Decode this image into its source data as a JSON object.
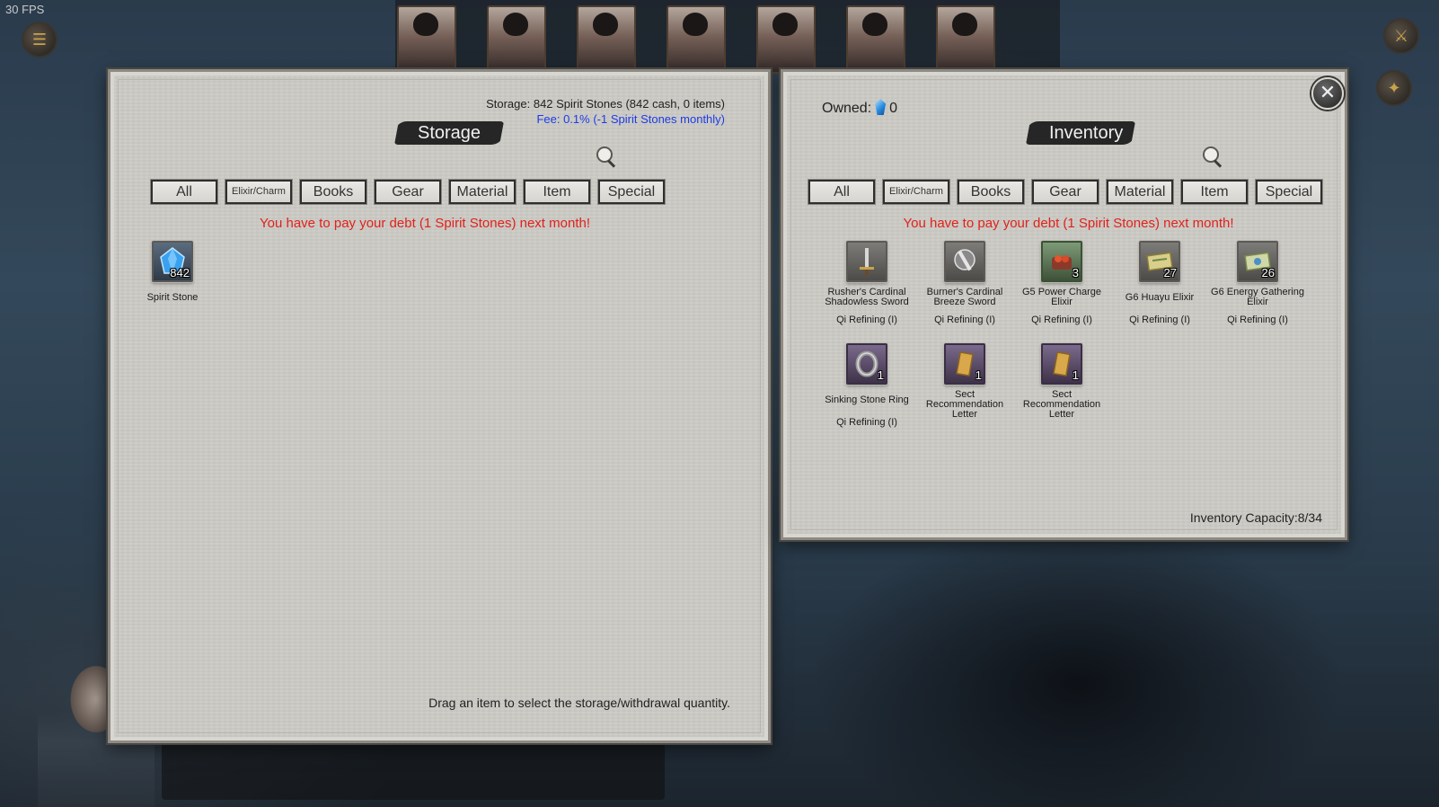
{
  "hud": {
    "fps": "30 FPS"
  },
  "storage": {
    "title": "Storage",
    "storage_line": "Storage: 842 Spirit Stones (842 cash, 0 items)",
    "fee_line": "Fee: 0.1% (-1 Spirit Stones monthly)",
    "tabs": [
      "All",
      "Elixir/Charm",
      "Books",
      "Gear",
      "Material",
      "Item",
      "Special"
    ],
    "debt_message": "You have to pay your debt (1 Spirit Stones) next month!",
    "items": [
      {
        "name": "Spirit Stone",
        "qty": "842",
        "icon": "spirit-stone-icon"
      }
    ],
    "footer": "Drag an item to select the storage/withdrawal quantity."
  },
  "inventory": {
    "title": "Inventory",
    "owned_label": "Owned:",
    "owned_value": "0",
    "tabs": [
      "All",
      "Elixir/Charm",
      "Books",
      "Gear",
      "Material",
      "Item",
      "Special"
    ],
    "debt_message": "You have to pay your debt (1 Spirit Stones) next month!",
    "items": [
      {
        "name": "Rusher's Cardinal Shadowless Sword",
        "qty": "",
        "realm": "Qi Refining (I)",
        "icon": "sword-icon"
      },
      {
        "name": "Burner's Cardinal Breeze Sword",
        "qty": "",
        "realm": "Qi Refining (I)",
        "icon": "sword-icon"
      },
      {
        "name": "G5 Power Charge Elixir",
        "qty": "3",
        "realm": "Qi Refining (I)",
        "icon": "elixir-icon"
      },
      {
        "name": "G6 Huayu Elixir",
        "qty": "27",
        "realm": "Qi Refining (I)",
        "icon": "scroll-icon"
      },
      {
        "name": "G6 Energy Gathering Elixir",
        "qty": "26",
        "realm": "Qi Refining (I)",
        "icon": "scroll-icon"
      },
      {
        "name": "Sinking Stone Ring",
        "qty": "1",
        "realm": "Qi Refining (I)",
        "icon": "ring-icon"
      },
      {
        "name": "Sect Recommendation Letter",
        "qty": "1",
        "realm": "",
        "icon": "letter-icon"
      },
      {
        "name": "Sect Recommendation Letter",
        "qty": "1",
        "realm": "",
        "icon": "letter-icon"
      }
    ],
    "capacity": "Inventory Capacity:8/34"
  }
}
